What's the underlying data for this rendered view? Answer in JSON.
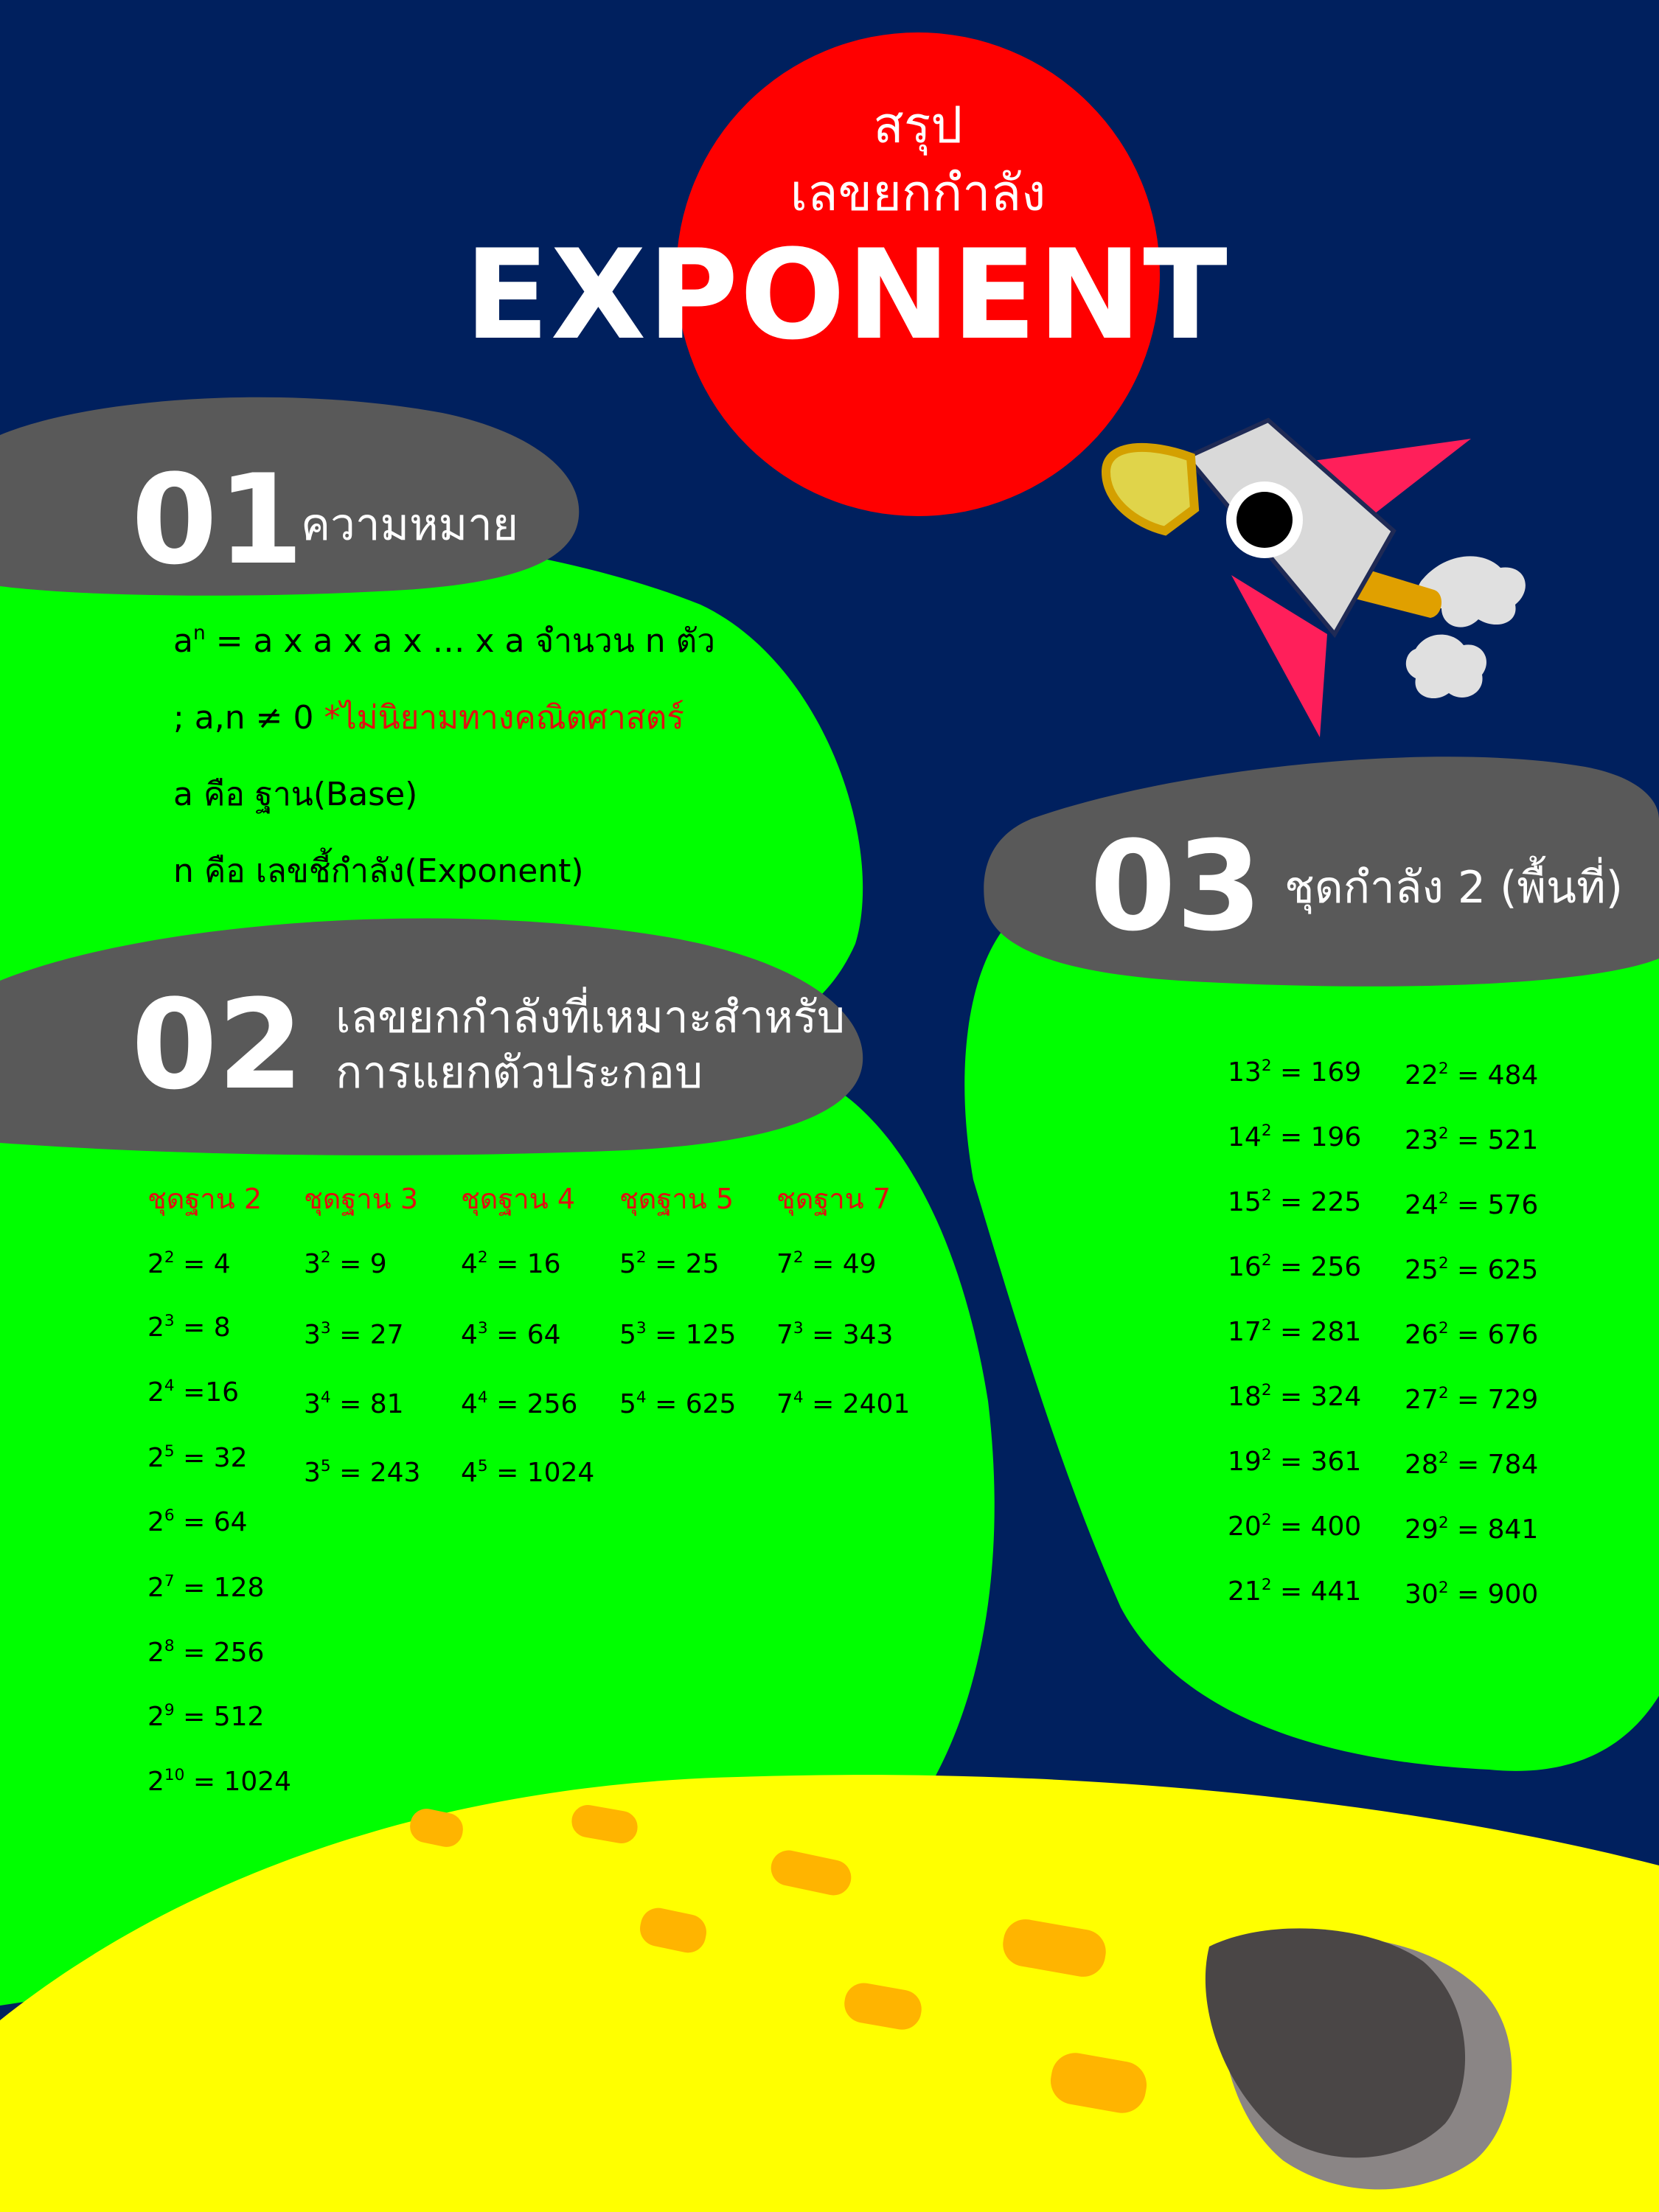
{
  "colors": {
    "background": "#00205e",
    "sun": "#ff0000",
    "green": "#00ff00",
    "label_pill": "#595959",
    "moon": "#ffff00",
    "crater": "#ffb400",
    "rock": "#4a4646",
    "accent_red": "#e01010"
  },
  "header": {
    "subtitle_line1": "สรุป",
    "subtitle_line2": "เลขยกกำลัง",
    "title": "EXPONENT"
  },
  "section1": {
    "number": "01",
    "title": "ความหมาย",
    "lines": [
      {
        "base": "a",
        "sup": "n",
        "rest": " = a x a x a x … x a จำนวน n ตัว"
      },
      {
        "prefix": "; a,n ≠ 0 ",
        "highlight": "*ไม่นิยามทางคณิตศาสตร์"
      },
      {
        "text": "a คือ ฐาน(Base)"
      },
      {
        "text": "n คือ เลขชี้กำลัง(Exponent)"
      }
    ]
  },
  "section2": {
    "number": "02",
    "title_line1": "เลขยกกำลังที่เหมาะสำหรับ",
    "title_line2": "การแยกตัวประกอบ",
    "columns": [
      {
        "header": "ชุดฐาน 2",
        "items": [
          {
            "b": "2",
            "e": "2",
            "v": " = 4"
          },
          {
            "b": "2",
            "e": "3",
            "v": " = 8"
          },
          {
            "b": "2",
            "e": "4",
            "v": " =16"
          },
          {
            "b": "2",
            "e": "5",
            "v": " = 32"
          },
          {
            "b": "2",
            "e": "6",
            "v": " = 64"
          },
          {
            "b": "2",
            "e": "7",
            "v": " = 128"
          },
          {
            "b": "2",
            "e": "8",
            "v": " = 256"
          },
          {
            "b": "2",
            "e": "9",
            "v": " = 512"
          },
          {
            "b": "2",
            "e": "10",
            "v": " = 1024"
          }
        ]
      },
      {
        "header": "ชุดฐาน 3",
        "items": [
          {
            "b": "3",
            "e": "2",
            "v": " = 9"
          },
          {
            "b": "3",
            "e": "3",
            "v": " = 27"
          },
          {
            "b": "3",
            "e": "4",
            "v": " = 81"
          },
          {
            "b": "3",
            "e": "5",
            "v": " = 243"
          }
        ]
      },
      {
        "header": "ชุดฐาน 4",
        "items": [
          {
            "b": "4",
            "e": "2",
            "v": " = 16"
          },
          {
            "b": "4",
            "e": "3",
            "v": " = 64"
          },
          {
            "b": "4",
            "e": "4",
            "v": " = 256"
          },
          {
            "b": "4",
            "e": "5",
            "v": " = 1024"
          }
        ]
      },
      {
        "header": "ชุดฐาน 5",
        "items": [
          {
            "b": "5",
            "e": "2",
            "v": " = 25"
          },
          {
            "b": "5",
            "e": "3",
            "v": " = 125"
          },
          {
            "b": "5",
            "e": "4",
            "v": " = 625"
          }
        ]
      },
      {
        "header": "ชุดฐาน 7",
        "items": [
          {
            "b": "7",
            "e": "2",
            "v": " = 49"
          },
          {
            "b": "7",
            "e": "3",
            "v": " = 343"
          },
          {
            "b": "7",
            "e": "4",
            "v": " = 2401"
          }
        ]
      }
    ]
  },
  "section3": {
    "number": "03",
    "title": "ชุดกำลัง 2 (พื้นที่)",
    "columns": [
      {
        "items": [
          {
            "b": "13",
            "e": "2",
            "v": " = 169"
          },
          {
            "b": "14",
            "e": "2",
            "v": " = 196"
          },
          {
            "b": "15",
            "e": "2",
            "v": " = 225"
          },
          {
            "b": "16",
            "e": "2",
            "v": " = 256"
          },
          {
            "b": "17",
            "e": "2",
            "v": " = 281"
          },
          {
            "b": "18",
            "e": "2",
            "v": " = 324"
          },
          {
            "b": "19",
            "e": "2",
            "v": " = 361"
          },
          {
            "b": "20",
            "e": "2",
            "v": " = 400"
          },
          {
            "b": "21",
            "e": "2",
            "v": " = 441"
          }
        ]
      },
      {
        "items": [
          {
            "b": "22",
            "e": "2",
            "v": " = 484"
          },
          {
            "b": "23",
            "e": "2",
            "v": " = 521"
          },
          {
            "b": "24",
            "e": "2",
            "v": " = 576"
          },
          {
            "b": "25",
            "e": "2",
            "v": " = 625"
          },
          {
            "b": "26",
            "e": "2",
            "v": " = 676"
          },
          {
            "b": "27",
            "e": "2",
            "v": " = 729"
          },
          {
            "b": "28",
            "e": "2",
            "v": " = 784"
          },
          {
            "b": "29",
            "e": "2",
            "v": " = 841"
          },
          {
            "b": "30",
            "e": "2",
            "v": " = 900"
          }
        ]
      }
    ]
  }
}
